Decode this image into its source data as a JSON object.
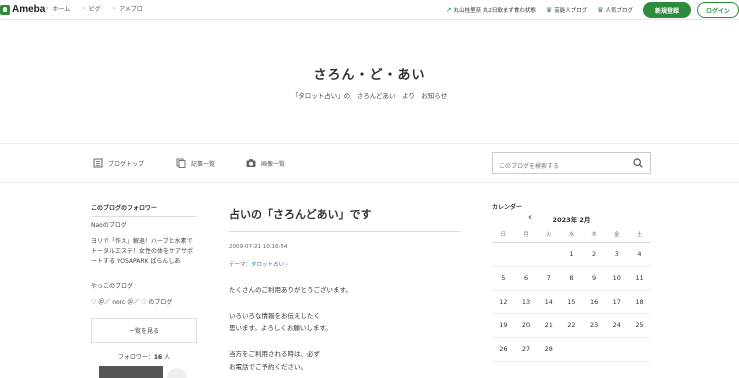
{
  "topbar": {
    "logo_text": "Ameba",
    "nav": [
      "ホーム",
      "ピグ",
      "アメブロ"
    ],
    "links": [
      {
        "label": "丸山桂里奈 丸2日飲まず食わ状態",
        "icon": "trend-icon"
      },
      {
        "label": "芸能人ブログ",
        "icon": "crown-icon"
      },
      {
        "label": "人気ブログ",
        "icon": "crown-icon"
      }
    ],
    "register_label": "新規登録",
    "login_label": "ログイン",
    "accent_color": "#2d8c3c"
  },
  "header": {
    "title": "さろん・ど・あい",
    "description": "「タロット占い」の　さろんどあい　より　お知らせ"
  },
  "nav": {
    "blog_top": "ブログトップ",
    "entry_list": "記事一覧",
    "image_list": "画像一覧",
    "search_placeholder": "このブログを検索する"
  },
  "sidebar": {
    "followers_heading": "このブログのフォロワー",
    "followers": [
      "Naoのブログ",
      "ヨリで「作え」解退！ハーブと水素でトータルエステ！女性の体をケアサポートする YOSAPARK ぱらんしあ",
      "やっこのブログ",
      "♡ ＠／ norc ＠／ ♡ のブログ"
    ],
    "more_label": "一覧を見る",
    "follower_count_label": "フォロワー：",
    "follower_count_value": "16",
    "follower_count_unit": "人"
  },
  "entry": {
    "title": "占いの「さろんどあい」です",
    "date": "2009-07-21 10:16:54",
    "theme_label": "テーマ：",
    "theme_value": "タロット占い",
    "paragraphs": [
      "たくさんのご利用ありがとうございます。",
      "いろいろな情報をお伝えしたく\n思います。よろしくお願いします。",
      "当方をご利用される時は、必ず\nお電話でご予約ください。"
    ]
  },
  "calendar": {
    "heading": "カレンダー",
    "month": "2023年 2月",
    "weekdays": [
      "日",
      "月",
      "火",
      "水",
      "木",
      "金",
      "土"
    ],
    "weeks": [
      [
        "",
        "",
        "",
        "1",
        "2",
        "3",
        "4"
      ],
      [
        "5",
        "6",
        "7",
        "8",
        "9",
        "10",
        "11"
      ],
      [
        "12",
        "13",
        "14",
        "15",
        "16",
        "17",
        "18"
      ],
      [
        "19",
        "20",
        "21",
        "22",
        "23",
        "24",
        "25"
      ],
      [
        "26",
        "27",
        "28",
        "",
        "",
        "",
        ""
      ]
    ]
  }
}
